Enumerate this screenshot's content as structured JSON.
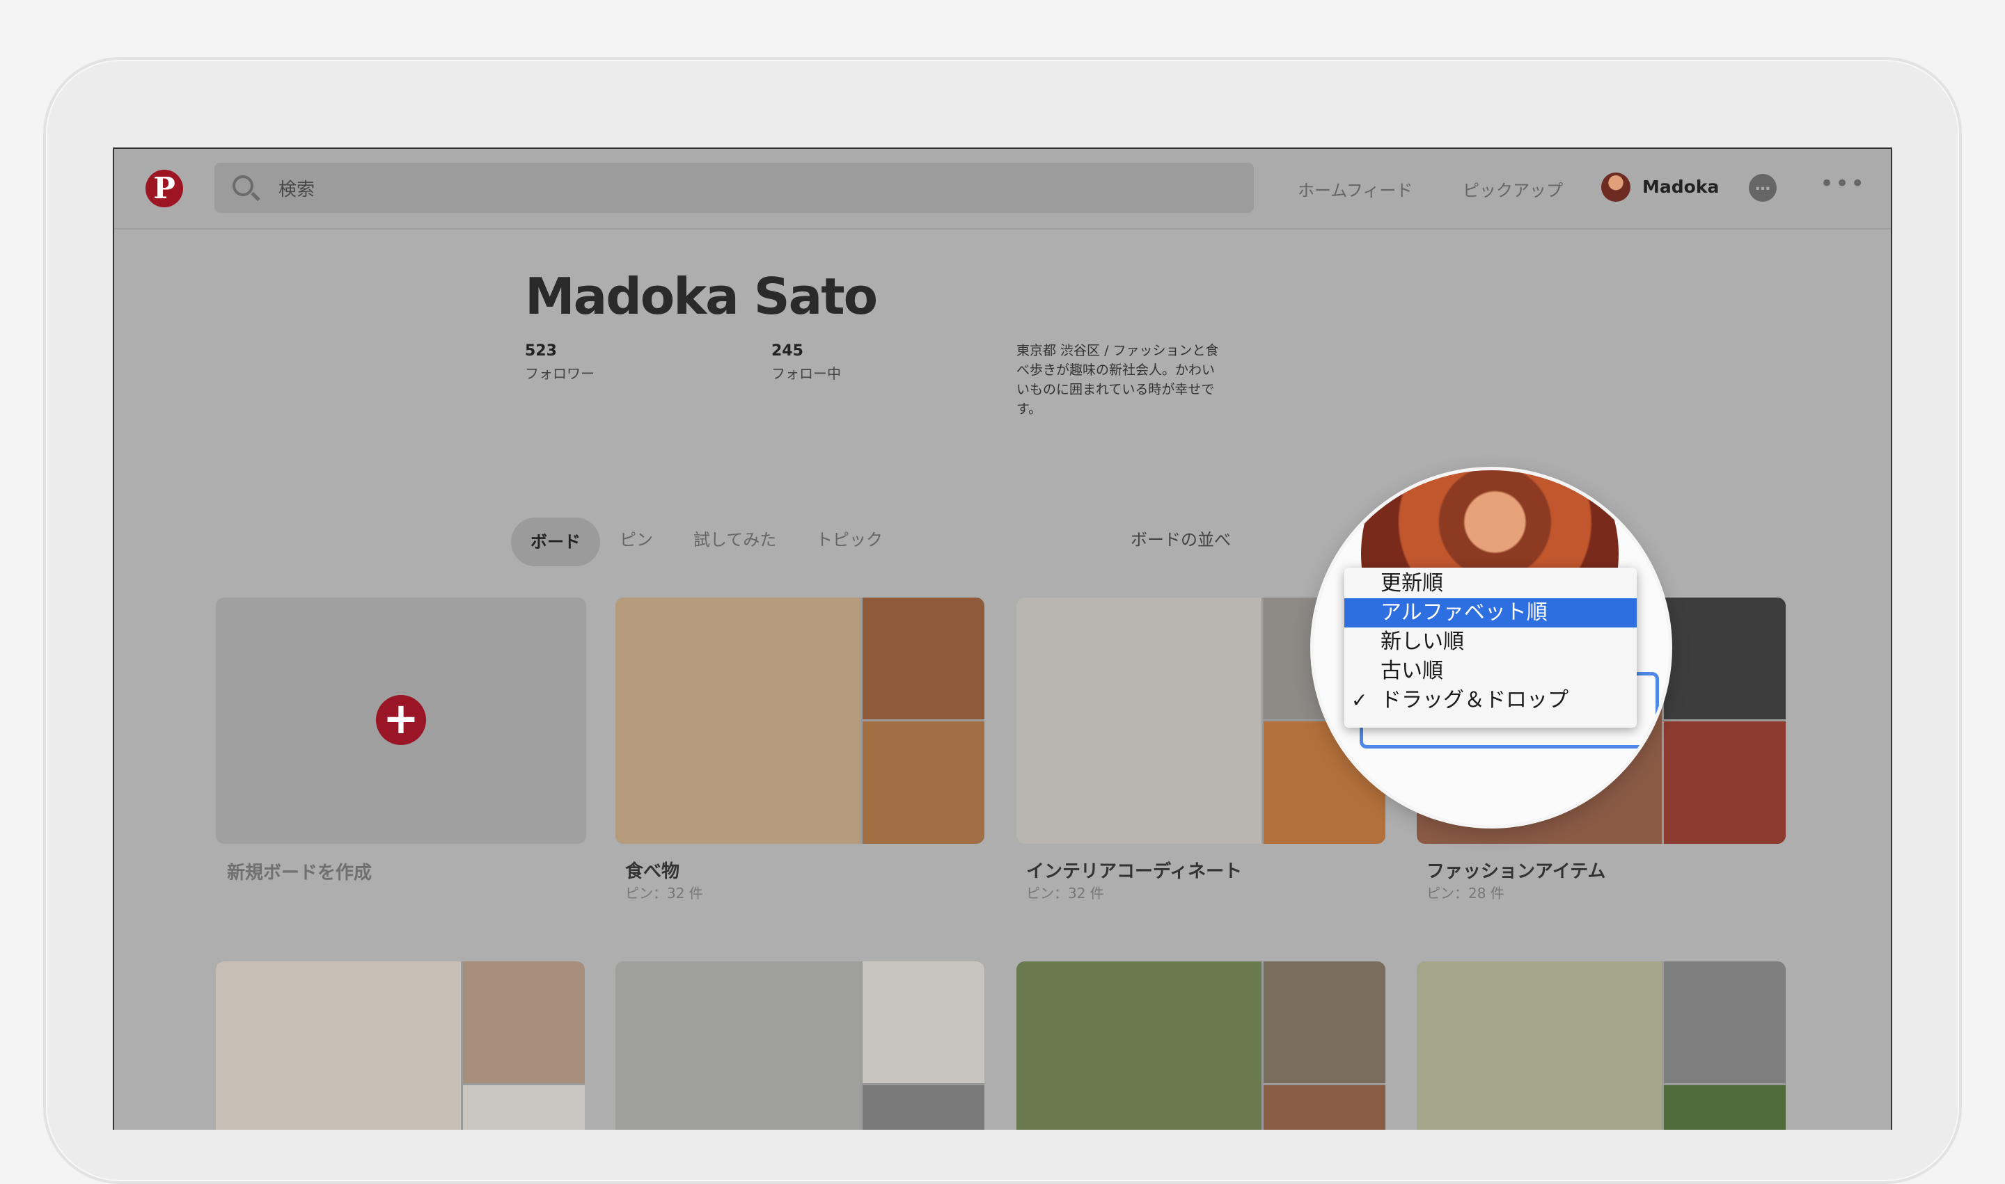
{
  "nav": {
    "logo": "P",
    "search_placeholder": "検索",
    "home_feed": "ホームフィード",
    "pickup": "ピックアップ",
    "user": "Madoka",
    "chat_icon": "…",
    "more": "•••"
  },
  "profile": {
    "name": "Madoka Sato",
    "followers_count": "523",
    "followers_label": "フォロワー",
    "following_count": "245",
    "following_label": "フォロー中",
    "bio": "東京都 渋谷区 / ファッションと食べ歩きが趣味の新社会人。かわいいものに囲まれている時が幸せです。"
  },
  "tabs": [
    "ボード",
    "ピン",
    "試してみた",
    "トピック"
  ],
  "sort": {
    "label": "ボードの並べ",
    "options": [
      "更新順",
      "アルファベット順",
      "新しい順",
      "古い順",
      "ドラッグ＆ドロップ"
    ],
    "highlighted": "アルファベット順",
    "checked": "ドラッグ＆ドロップ"
  },
  "new_board": {
    "label": "新規ボードを作成"
  },
  "boards": [
    {
      "title": "食べ物",
      "sub": "ピン：32 件",
      "colors": [
        "#b59a7c",
        "#8f5a3a",
        "#a26e44"
      ]
    },
    {
      "title": "インテリアコーディネート",
      "sub": "ピン：32 件",
      "colors": [
        "#b9b6b1",
        "#8d8a86",
        "#b3703b"
      ]
    },
    {
      "title": "ファッションアイテム",
      "sub": "ピン：28 件",
      "colors": [
        "#8a5a45",
        "#3d3d3d",
        "#8d3b2e"
      ]
    }
  ],
  "boards_row2": [
    {
      "colors": [
        "#c7bfb6",
        "#a58e7c",
        "#c9c6c2"
      ]
    },
    {
      "colors": [
        "#9f9f9d",
        "#c8c4bf",
        "#7a7a7a"
      ]
    },
    {
      "colors": [
        "#6a7a4f",
        "#7a6d5e",
        "#8a5e45"
      ]
    },
    {
      "colors": [
        "#a5a58a",
        "#7e7e7e",
        "#4f6b3a"
      ]
    }
  ]
}
